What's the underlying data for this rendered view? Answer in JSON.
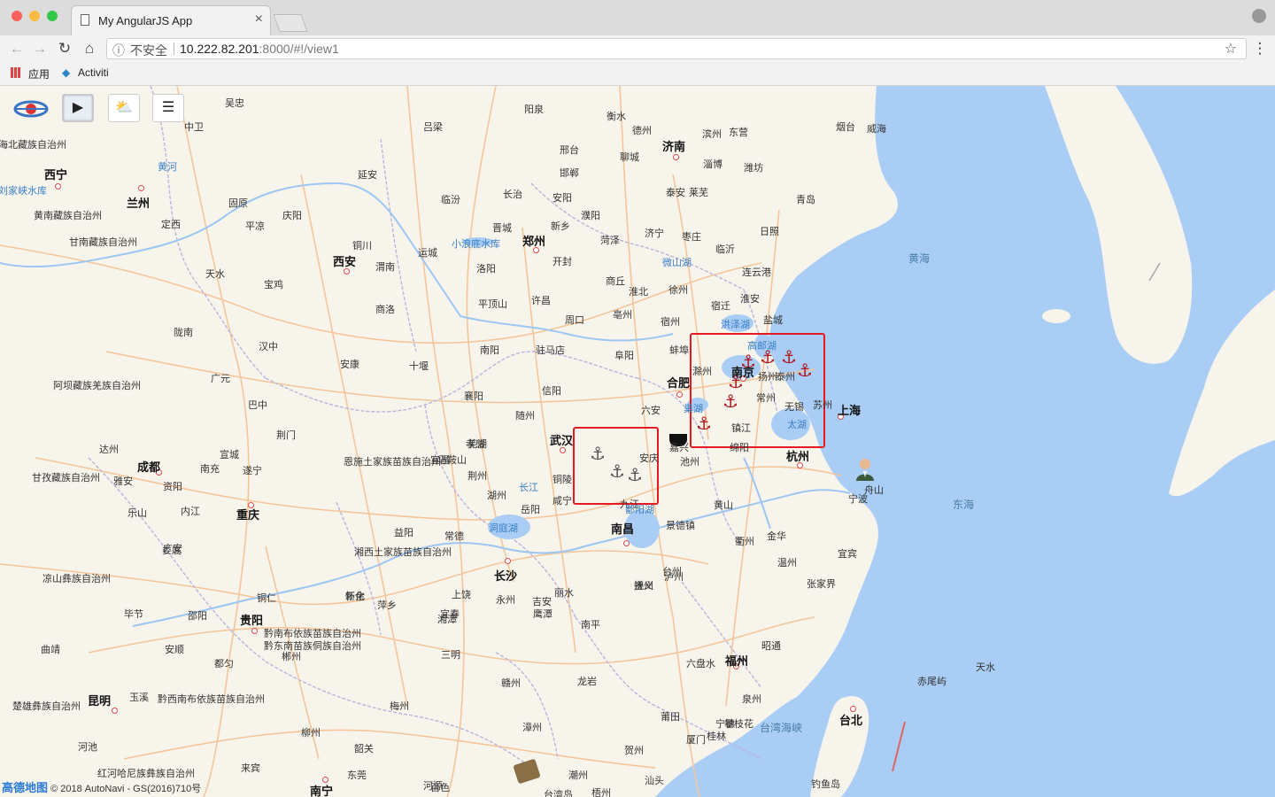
{
  "browser": {
    "tab_title": "My AngularJS App",
    "tab_close": "×",
    "insecure_label": "不安全",
    "url_host": "10.222.82.201",
    "url_rest": ":8000/#!/view1",
    "bookmarks": [
      "应用",
      "Activiti"
    ]
  },
  "map_controls": {
    "play": "▶",
    "layers": "⛅",
    "menu": "☰"
  },
  "map_labels": {
    "cities_big": [
      "西宁",
      "兰州",
      "西安",
      "郑州",
      "济南",
      "成都",
      "重庆",
      "武汉",
      "合肥",
      "南京",
      "上海",
      "杭州",
      "长沙",
      "南昌",
      "贵阳",
      "昆明",
      "福州",
      "台北",
      "南宁"
    ],
    "cities": [
      "中卫",
      "吴忠",
      "吕梁",
      "阳泉",
      "衡水",
      "德州",
      "滨州",
      "东营",
      "烟台",
      "威海",
      "邢台",
      "邯郸",
      "聊城",
      "淄博",
      "潍坊",
      "青岛",
      "泰安",
      "莱芜",
      "长治",
      "安阳",
      "延安",
      "临汾",
      "晋城",
      "新乡",
      "濮阳",
      "菏泽",
      "济宁",
      "枣庄",
      "临沂",
      "日照",
      "定西",
      "平凉",
      "庆阳",
      "固原",
      "运城",
      "洛阳",
      "开封",
      "商丘",
      "淮北",
      "徐州",
      "连云港",
      "天水",
      "宝鸡",
      "铜川",
      "渭南",
      "平顶山",
      "许昌",
      "周口",
      "亳州",
      "宿州",
      "宿迁",
      "淮安",
      "盐城",
      "陇南",
      "汉中",
      "商洛",
      "南阳",
      "驻马店",
      "阜阳",
      "蚌埠",
      "滁州",
      "扬州",
      "泰州",
      "安康",
      "十堰",
      "信阳",
      "六安",
      "镇江",
      "常州",
      "无锡",
      "苏州",
      "广元",
      "巴中",
      "襄阳",
      "随州",
      "芜湖",
      "马鞍山",
      "湖州",
      "嘉兴",
      "绵阳",
      "达州",
      "荆门",
      "孝感",
      "铜陵",
      "宣城",
      "南充",
      "遂宁",
      "广安",
      "宜昌",
      "荆州",
      "黄山",
      "池州",
      "安庆",
      "舟山",
      "宁波",
      "雅安",
      "资阳",
      "内江",
      "岳阳",
      "咸宁",
      "九江",
      "景德镇",
      "衢州",
      "金华",
      "乐山",
      "常德",
      "益阳",
      "上饶",
      "丽水",
      "台州",
      "温州",
      "宜宾",
      "张家界",
      "娄底",
      "新余",
      "宜春",
      "鹰潭",
      "抚州",
      "泸州",
      "遵义",
      "铜仁",
      "怀化",
      "萍乡",
      "吉安",
      "南平",
      "宁德",
      "昭通",
      "毕节",
      "邵阳",
      "湘潭",
      "永州",
      "三明",
      "六盘水",
      "安顺",
      "都匀",
      "郴州",
      "赣州",
      "龙岩",
      "莆田",
      "泉州",
      "攀枝花",
      "曲靖",
      "玉溪",
      "河池",
      "柳州",
      "韶关",
      "漳州",
      "厦门",
      "桂林",
      "梅州",
      "贺州",
      "河源",
      "潮州",
      "汕头",
      "梧州",
      "百色",
      "来宾",
      "东莞",
      "台湾岛",
      "钓鱼岛",
      "赤尾屿",
      "天水"
    ],
    "regions": [
      "海北藏族自治州",
      "黄南藏族自治州",
      "甘南藏族自治州",
      "阿坝藏族羌族自治州",
      "甘孜藏族自治州",
      "凉山彝族自治州",
      "恩施土家族苗族自治州",
      "湘西土家族苗族自治州",
      "黔东南苗族侗族自治州",
      "黔南布依族苗族自治州",
      "黔西南布依族苗族自治州",
      "红河哈尼族彝族自治州",
      "楚雄彝族自治州"
    ],
    "water": [
      "黄河",
      "长江",
      "小浪底水库",
      "微山湖",
      "洪泽湖",
      "高邮湖",
      "巢湖",
      "太湖",
      "洞庭湖",
      "鄱阳湖",
      "刘家峡水库"
    ],
    "seas": [
      "黄海",
      "东海",
      "台湾海峡"
    ]
  },
  "copyright": {
    "brand": "高德地图",
    "text": "© 2018 AutoNavi - GS(2016)710号"
  },
  "colors": {
    "land": "#f7f4ec",
    "sea": "#a9cdf5",
    "highway": "#f5c59a",
    "boundary": "#b9b4dd",
    "river": "#a9cdf5",
    "highlight": "#e41b23"
  }
}
